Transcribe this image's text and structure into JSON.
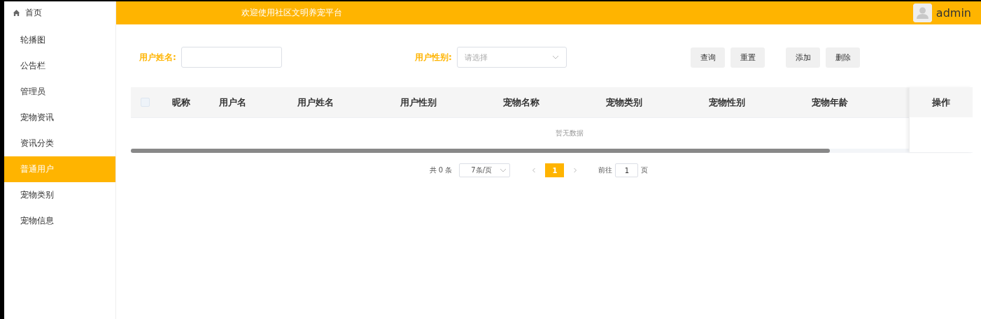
{
  "sidebar": {
    "items": [
      {
        "label": "首页",
        "kind": "home",
        "selected": false
      },
      {
        "label": "轮播图",
        "kind": "link",
        "selected": false
      },
      {
        "label": "公告栏",
        "kind": "link",
        "selected": false
      },
      {
        "label": "管理员",
        "kind": "link",
        "selected": false
      },
      {
        "label": "宠物资讯",
        "kind": "link",
        "selected": false
      },
      {
        "label": "资讯分类",
        "kind": "link",
        "selected": false
      },
      {
        "label": "普通用户",
        "kind": "link",
        "selected": true
      },
      {
        "label": "宠物类别",
        "kind": "link",
        "selected": false
      },
      {
        "label": "宠物信息",
        "kind": "link",
        "selected": false
      }
    ]
  },
  "header": {
    "title": "欢迎使用社区文明养宠平台",
    "user": "admin"
  },
  "search": {
    "fields": [
      {
        "label": "用户姓名:",
        "kind": "text"
      },
      {
        "label": "用户性别:",
        "kind": "select",
        "placeholder": "请选择"
      }
    ],
    "search_buttons": [
      "查询",
      "重置"
    ],
    "action_buttons": [
      "添加",
      "删除"
    ]
  },
  "table": {
    "select_all": {
      "checked": false
    },
    "columns": [
      "昵称",
      "用户名",
      "用户姓名",
      "用户性别",
      "宠物名称",
      "宠物类别",
      "宠物性别",
      "宠物年龄"
    ],
    "fixed_column": "操作",
    "empty_text": "暂无数据"
  },
  "pagination": {
    "total": "共 0 条",
    "page_size": "7条/页",
    "pages": [
      {
        "label": "1",
        "selected": true
      }
    ],
    "jump_label": "前往",
    "jump_value": "1",
    "jump_suffix": "页"
  }
}
